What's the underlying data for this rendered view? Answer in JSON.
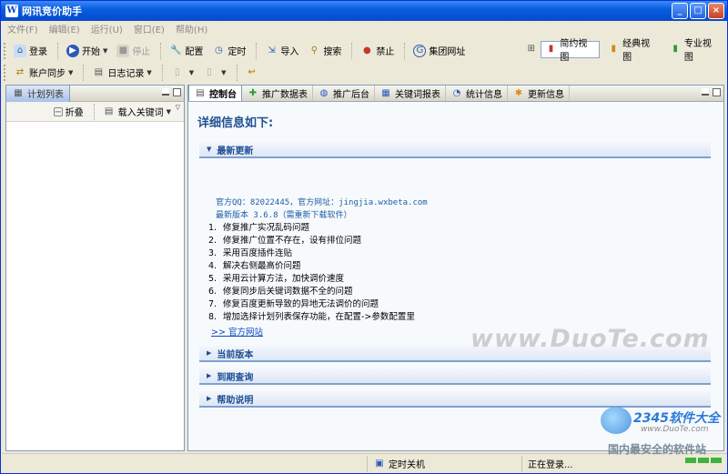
{
  "window": {
    "title": "网讯竞价助手",
    "icon": "W"
  },
  "menu": [
    "文件(F)",
    "编辑(E)",
    "运行(U)",
    "窗口(E)",
    "帮助(H)"
  ],
  "toolbar": {
    "login": "登录",
    "start": "开始",
    "stop": "停止",
    "config": "配置",
    "timer": "定时",
    "import": "导入",
    "search": "搜索",
    "ban": "禁止",
    "group_url": "集团网址",
    "account_sync": "账户同步",
    "log": "日志记录"
  },
  "views": {
    "simple": "简约视图",
    "classic": "经典视图",
    "pro": "专业视图"
  },
  "left_pane": {
    "tab": "计划列表",
    "collapse": "折叠",
    "load_keywords": "载入关键词"
  },
  "tabs": [
    "控制台",
    "推广数据表",
    "推广后台",
    "关键词报表",
    "统计信息",
    "更新信息"
  ],
  "content": {
    "heading": "详细信息如下:",
    "sections": {
      "latest": "最新更新",
      "current": "当前版本",
      "expire": "到期查询",
      "help": "帮助说明"
    },
    "official_info": "官方QQ：82022445，官方网址：jingjia.wxbeta.com",
    "latest_version": "最新版本 3.6.8（需重新下载软件）",
    "fixes": [
      {
        "n": "1.",
        "text": "修复推广实况乱码问题"
      },
      {
        "n": "2.",
        "text": "修复推广位置不存在，设有排位问题"
      },
      {
        "n": "3.",
        "text": "采用百度插件连贴"
      },
      {
        "n": "4.",
        "text": "解决右侧最高价问题"
      },
      {
        "n": "5.",
        "text": "采用云计算方法，加快调价速度"
      },
      {
        "n": "6.",
        "text": "修复同步后关键词数据不全的问题"
      },
      {
        "n": "7.",
        "text": "修复百度更新导致的异地无法调价的问题"
      },
      {
        "n": "8.",
        "text": "增加选择计划列表保存功能，在配置->参数配置里"
      }
    ],
    "official_link": ">> 官方网站"
  },
  "watermark": "www.DuoTe.com",
  "status": {
    "shutdown": "定时关机",
    "state": "正在登录..."
  },
  "brand": {
    "name": "2345软件大全",
    "url": "www.DuoTe.com",
    "slogan": "国内最安全的软件站"
  }
}
